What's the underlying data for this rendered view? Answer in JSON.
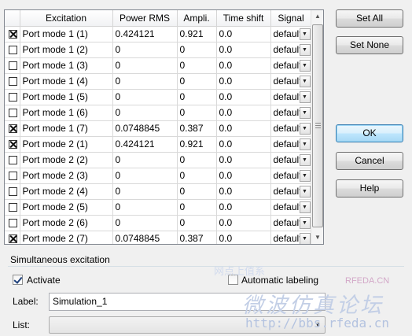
{
  "table": {
    "headers": [
      "Excitation",
      "Power RMS",
      "Ampli.",
      "Time shift",
      "Signal"
    ],
    "rows": [
      {
        "checked": true,
        "excitation": "Port mode 1 (1)",
        "power": "0.424121",
        "ampli": "0.921",
        "shift": "0.0",
        "signal": "default"
      },
      {
        "checked": false,
        "excitation": "Port mode 1 (2)",
        "power": "0",
        "ampli": "0",
        "shift": "0.0",
        "signal": "default"
      },
      {
        "checked": false,
        "excitation": "Port mode 1 (3)",
        "power": "0",
        "ampli": "0",
        "shift": "0.0",
        "signal": "default"
      },
      {
        "checked": false,
        "excitation": "Port mode 1 (4)",
        "power": "0",
        "ampli": "0",
        "shift": "0.0",
        "signal": "default"
      },
      {
        "checked": false,
        "excitation": "Port mode 1 (5)",
        "power": "0",
        "ampli": "0",
        "shift": "0.0",
        "signal": "default"
      },
      {
        "checked": false,
        "excitation": "Port mode 1 (6)",
        "power": "0",
        "ampli": "0",
        "shift": "0.0",
        "signal": "default"
      },
      {
        "checked": true,
        "excitation": "Port mode 1 (7)",
        "power": "0.0748845",
        "ampli": "0.387",
        "shift": "0.0",
        "signal": "default"
      },
      {
        "checked": true,
        "excitation": "Port mode 2 (1)",
        "power": "0.424121",
        "ampli": "0.921",
        "shift": "0.0",
        "signal": "default"
      },
      {
        "checked": false,
        "excitation": "Port mode 2 (2)",
        "power": "0",
        "ampli": "0",
        "shift": "0.0",
        "signal": "default"
      },
      {
        "checked": false,
        "excitation": "Port mode 2 (3)",
        "power": "0",
        "ampli": "0",
        "shift": "0.0",
        "signal": "default"
      },
      {
        "checked": false,
        "excitation": "Port mode 2 (4)",
        "power": "0",
        "ampli": "0",
        "shift": "0.0",
        "signal": "default"
      },
      {
        "checked": false,
        "excitation": "Port mode 2 (5)",
        "power": "0",
        "ampli": "0",
        "shift": "0.0",
        "signal": "default"
      },
      {
        "checked": false,
        "excitation": "Port mode 2 (6)",
        "power": "0",
        "ampli": "0",
        "shift": "0.0",
        "signal": "default"
      },
      {
        "checked": true,
        "excitation": "Port mode 2 (7)",
        "power": "0.0748845",
        "ampli": "0.387",
        "shift": "0.0",
        "signal": "default"
      }
    ]
  },
  "buttons": {
    "set_all": "Set All",
    "set_none": "Set None",
    "ok": "OK",
    "cancel": "Cancel",
    "help": "Help"
  },
  "simultaneous": {
    "title": "Simultaneous excitation",
    "activate_label": "Activate",
    "activate_checked": true,
    "auto_label": "Automatic labeling",
    "auto_checked": false,
    "label_caption": "Label:",
    "label_value": "Simulation_1",
    "list_caption": "List:",
    "list_value": ""
  },
  "icons": {
    "checkbox_mark": "cross-check-icon",
    "dropdown": "chevron-down-icon",
    "scroll_up": "arrow-up-icon",
    "scroll_down": "arrow-down-icon"
  },
  "watermark": {
    "line1": "网点上值系",
    "brand": "RFEDA.CN",
    "cn": "微波仿真论坛",
    "url": "http://bbs.rfeda.cn"
  },
  "colors": {
    "default_button": "#bee6fd",
    "grid_border": "#828790",
    "watermark": "#c3cfe6"
  }
}
